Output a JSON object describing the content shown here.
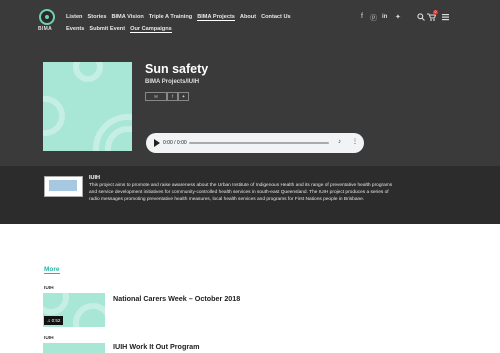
{
  "header": {
    "logo_text": "BIMA",
    "nav_row1": [
      "Listen",
      "Stories",
      "BIMA Vision",
      "Triple A Training",
      "BIMA Projects",
      "About",
      "Contact Us"
    ],
    "nav_row2": [
      "Events",
      "Submit Event",
      "Our Campaigns"
    ],
    "social": [
      "f",
      "ⓟ",
      "in",
      "✦"
    ],
    "cart_count": "0",
    "icons": [
      "search-icon",
      "cart-icon",
      "menu-icon"
    ]
  },
  "episode": {
    "title": "Sun safety",
    "subtitle": "BIMA Projects/IUIH",
    "share": [
      "✉",
      "f",
      "✦"
    ]
  },
  "player": {
    "time": "0:00 / 0:00"
  },
  "org": {
    "name": "IUIH",
    "description": "This project aims to promote and raise awareness about the Urban Institute of Indigenous Health and its range of preventative health programs and service development initiatives for community-controlled health services in south-east Queensland.  The IUIH project produces a series of radio messages promoting preventative health measures, local health services and programs for First Nations people in Brisbane."
  },
  "more_label": "More",
  "episodes": [
    {
      "category": "IUIH",
      "title": "National Carers Week – October 2018",
      "duration": "0:52"
    },
    {
      "category": "IUIH",
      "title": "IUIH Work It Out Program"
    }
  ],
  "colors": {
    "accent": "#2bb3a3",
    "cover": "#a8e6d6",
    "hero": "#3a3a3a"
  }
}
